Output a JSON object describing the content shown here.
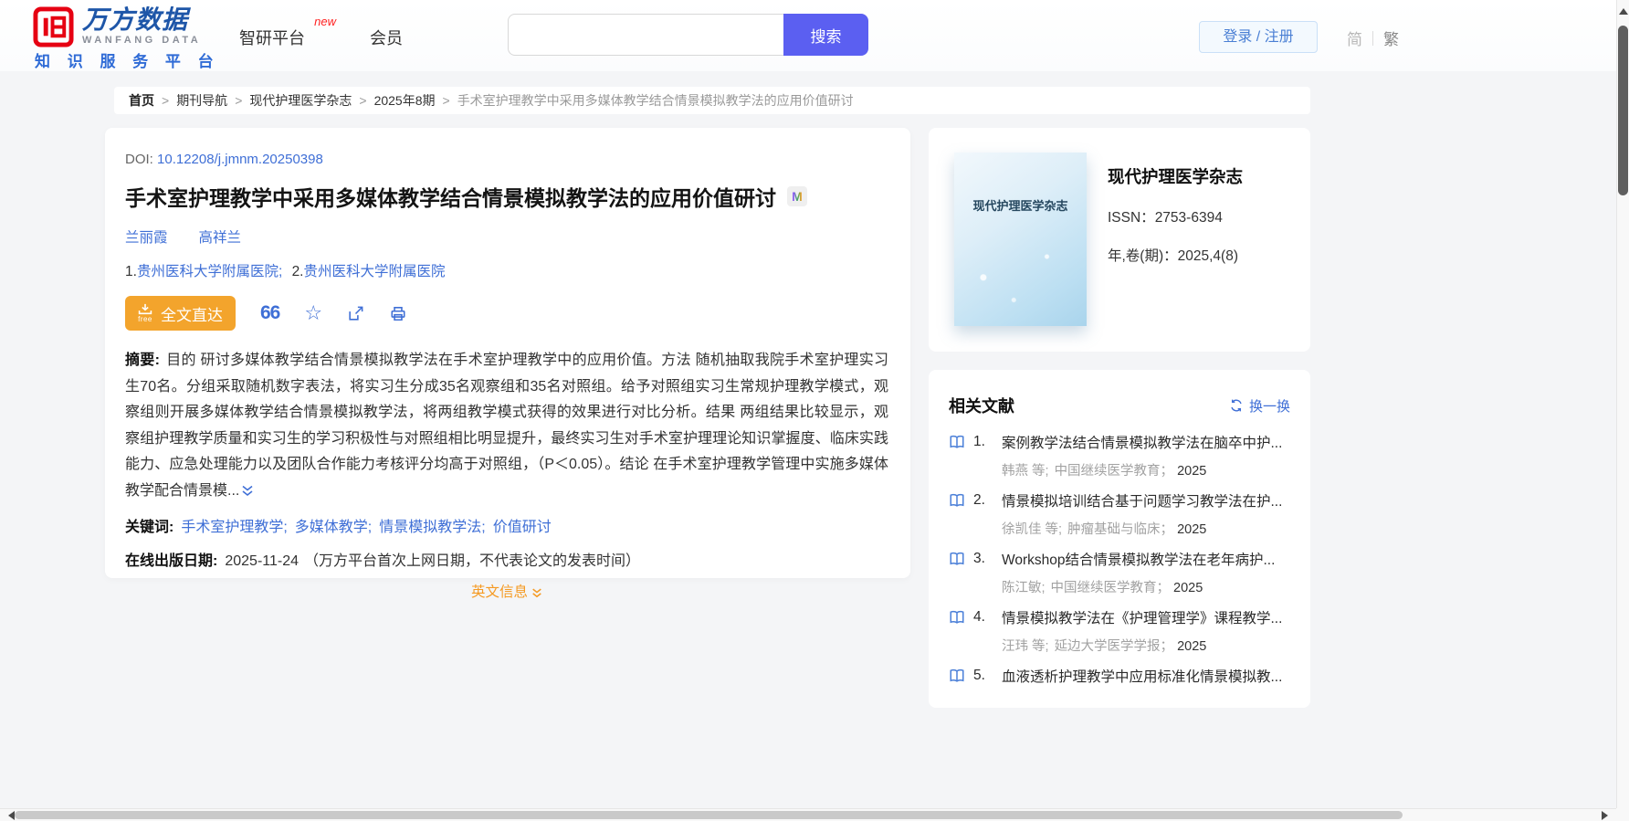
{
  "colors": {
    "brand_red": "#e60012",
    "brand_blue": "#1e56a8",
    "link_blue": "#3f6fd6",
    "accent_orange": "#f3a42c",
    "search_purple": "#5b5ff1",
    "english_orange": "#f59a23"
  },
  "header": {
    "brand_cn": "万方数据",
    "brand_en": "WANFANG DATA",
    "brand_sub": "知 识 服 务 平 台",
    "nav_platform": "智研平台",
    "nav_platform_badge": "new",
    "nav_member": "会员",
    "search_button": "搜索",
    "login_register": "登录 / 注册",
    "lang_simplified": "简",
    "lang_traditional": "繁"
  },
  "breadcrumb": {
    "separator": ">",
    "home": "首页",
    "items": [
      "期刊导航",
      "现代护理医学杂志",
      "2025年8期"
    ],
    "current": "手术室护理教学中采用多媒体教学结合情景模拟教学法的应用价值研讨"
  },
  "article": {
    "doi_label": "DOI:",
    "doi": "10.12208/j.jmnm.20250398",
    "title": "手术室护理教学中采用多媒体教学结合情景模拟教学法的应用价值研讨",
    "title_badge": "M",
    "authors": [
      "兰丽霞",
      "高祥兰"
    ],
    "affiliations": [
      {
        "num": "1.",
        "name": "贵州医科大学附属医院;"
      },
      {
        "num": "2.",
        "name": "贵州医科大学附属医院"
      }
    ],
    "fulltext_label": "全文直达",
    "fulltext_free": "free",
    "quote_icon": "66",
    "star_icon": "☆",
    "abstract_label": "摘要:",
    "abstract_text": "目的 研讨多媒体教学结合情景模拟教学法在手术室护理教学中的应用价值。方法 随机抽取我院手术室护理实习生70名。分组采取随机数字表法，将实习生分成35名观察组和35名对照组。给予对照组实习生常规护理教学模式，观察组则开展多媒体教学结合情景模拟教学法，将两组教学模式获得的效果进行对比分析。结果 两组结果比较显示，观察组护理教学质量和实习生的学习积极性与对照组相比明显提升，最终实习生对手术室护理理论知识掌握度、临床实践能力、应急处理能力以及团队合作能力考核评分均高于对照组，（P＜0.05）。结论 在手术室护理教学管理中实施多媒体教学配合情景模...",
    "keywords_label": "关键词:",
    "keywords": [
      "手术室护理教学;",
      "多媒体教学;",
      "情景模拟教学法;",
      "价值研讨"
    ],
    "online_date_label": "在线出版日期:",
    "online_date": "2025-11-24",
    "online_date_note": "（万方平台首次上网日期，不代表论文的发表时间）",
    "english_info": "英文信息"
  },
  "journal": {
    "cover_title": "现代护理医学杂志",
    "title": "现代护理医学杂志",
    "issn_label": "ISSN：",
    "issn": "2753-6394",
    "vol_label": "年,卷(期)：",
    "vol": "2025,4(8)"
  },
  "related": {
    "title": "相关文献",
    "refresh": "换一换",
    "items": [
      {
        "num": "1.",
        "title": "案例教学法结合情景模拟教学法在脑卒中护...",
        "authors": "韩燕 等;",
        "source": "中国继续医学教育；",
        "year": "2025"
      },
      {
        "num": "2.",
        "title": "情景模拟培训结合基于问题学习教学法在护...",
        "authors": "徐凯佳 等;",
        "source": "肿瘤基础与临床；",
        "year": "2025"
      },
      {
        "num": "3.",
        "title": "Workshop结合情景模拟教学法在老年病护...",
        "authors": "陈江敏;",
        "source": "中国继续医学教育；",
        "year": "2025"
      },
      {
        "num": "4.",
        "title": "情景模拟教学法在《护理管理学》课程教学...",
        "authors": "汪玮 等;",
        "source": "延边大学医学学报；",
        "year": "2025"
      },
      {
        "num": "5.",
        "title": "血液透析护理教学中应用标准化情景模拟教...",
        "authors": "",
        "source": "",
        "year": ""
      }
    ]
  }
}
